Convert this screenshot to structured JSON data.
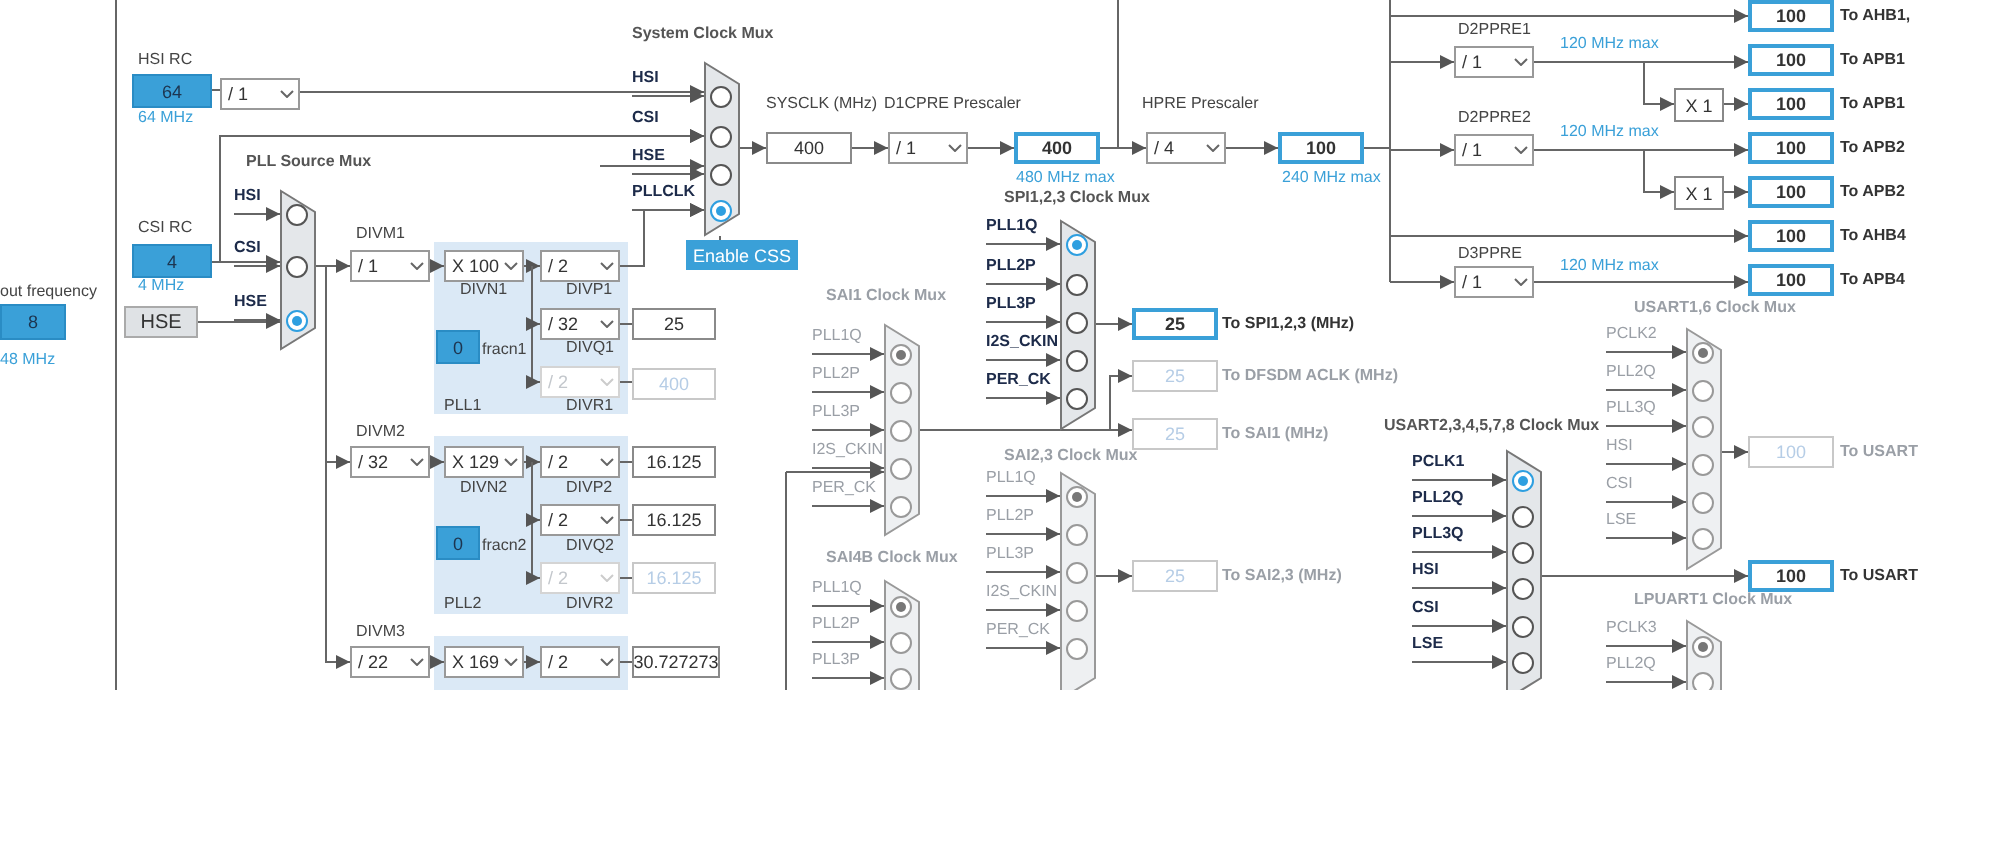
{
  "labels": [
    {
      "text": "out frequency",
      "kind": "caption"
    },
    {
      "text": "48 MHz",
      "kind": "note"
    },
    {
      "text": "HSI RC",
      "kind": "caption"
    },
    {
      "text": "64 MHz",
      "kind": "note"
    },
    {
      "text": "CSI RC",
      "kind": "caption"
    },
    {
      "text": "4 MHz",
      "kind": "note"
    },
    {
      "text": "DIVM1",
      "kind": "caption"
    },
    {
      "text": "DIVN1",
      "kind": "caption"
    },
    {
      "text": "DIVP1",
      "kind": "caption"
    },
    {
      "text": "DIVQ1",
      "kind": "caption"
    },
    {
      "text": "fracn1",
      "kind": "caption"
    },
    {
      "text": "DIVR1",
      "kind": "caption"
    },
    {
      "text": "PLL1",
      "kind": "caption"
    },
    {
      "text": "DIVM2",
      "kind": "caption"
    },
    {
      "text": "DIVN2",
      "kind": "caption"
    },
    {
      "text": "DIVP2",
      "kind": "caption"
    },
    {
      "text": "DIVQ2",
      "kind": "caption"
    },
    {
      "text": "fracn2",
      "kind": "caption"
    },
    {
      "text": "DIVR2",
      "kind": "caption"
    },
    {
      "text": "PLL2",
      "kind": "caption"
    },
    {
      "text": "DIVM3",
      "kind": "caption"
    },
    {
      "text": "SYSCLK (MHz)",
      "kind": "caption"
    },
    {
      "text": "D1CPRE Prescaler",
      "kind": "caption"
    },
    {
      "text": "480 MHz max",
      "kind": "note"
    },
    {
      "text": "HPRE Prescaler",
      "kind": "caption"
    },
    {
      "text": "240 MHz max",
      "kind": "note"
    },
    {
      "text": "D2PPRE1",
      "kind": "caption"
    },
    {
      "text": "120 MHz max",
      "kind": "note"
    },
    {
      "text": "D2PPRE2",
      "kind": "caption"
    },
    {
      "text": "120 MHz max",
      "kind": "note"
    },
    {
      "text": "D3PPRE",
      "kind": "caption"
    },
    {
      "text": "120 MHz max",
      "kind": "note"
    },
    {
      "text": "To AHB1,",
      "kind": "output"
    },
    {
      "text": "To APB1",
      "kind": "output"
    },
    {
      "text": "To APB1",
      "kind": "output"
    },
    {
      "text": "To APB2",
      "kind": "output"
    },
    {
      "text": "To APB2",
      "kind": "output"
    },
    {
      "text": "To AHB4",
      "kind": "output"
    },
    {
      "text": "To APB4",
      "kind": "output"
    },
    {
      "text": "To SPI1,2,3 (MHz)",
      "kind": "output"
    },
    {
      "text": "To DFSDM ACLK (MHz)",
      "kind": "output_off"
    },
    {
      "text": "To SAI1 (MHz)",
      "kind": "output_off"
    },
    {
      "text": "To SAI2,3 (MHz)",
      "kind": "output_off"
    },
    {
      "text": "To USART",
      "kind": "output_off"
    },
    {
      "text": "To USART",
      "kind": "output"
    }
  ],
  "fields": [
    {
      "value": "8",
      "kind": "source",
      "disabled": false
    },
    {
      "value": "64",
      "kind": "source",
      "disabled": false
    },
    {
      "value": "4",
      "kind": "source",
      "disabled": false
    },
    {
      "value": "0",
      "kind": "source",
      "disabled": false
    },
    {
      "value": "0",
      "kind": "source",
      "disabled": false
    },
    {
      "value": "25",
      "kind": "plain",
      "disabled": false
    },
    {
      "value": "400",
      "kind": "plain",
      "disabled": true
    },
    {
      "value": "16.125",
      "kind": "plain",
      "disabled": false
    },
    {
      "value": "16.125",
      "kind": "plain",
      "disabled": false
    },
    {
      "value": "16.125",
      "kind": "plain",
      "disabled": true
    },
    {
      "value": "30.727273",
      "kind": "plain",
      "disabled": false
    },
    {
      "value": "400",
      "kind": "plain",
      "disabled": false
    },
    {
      "value": "400",
      "kind": "output",
      "disabled": false
    },
    {
      "value": "100",
      "kind": "output",
      "disabled": false
    },
    {
      "value": "100",
      "kind": "output",
      "disabled": false
    },
    {
      "value": "100",
      "kind": "output",
      "disabled": false
    },
    {
      "value": "100",
      "kind": "output",
      "disabled": false
    },
    {
      "value": "100",
      "kind": "output",
      "disabled": false
    },
    {
      "value": "100",
      "kind": "output",
      "disabled": false
    },
    {
      "value": "100",
      "kind": "output",
      "disabled": false
    },
    {
      "value": "100",
      "kind": "output",
      "disabled": false
    },
    {
      "value": "25",
      "kind": "output",
      "disabled": false
    },
    {
      "value": "25",
      "kind": "plain",
      "disabled": true
    },
    {
      "value": "25",
      "kind": "plain",
      "disabled": true
    },
    {
      "value": "25",
      "kind": "plain",
      "disabled": true
    },
    {
      "value": "100",
      "kind": "plain",
      "disabled": true
    },
    {
      "value": "100",
      "kind": "output",
      "disabled": false
    }
  ],
  "dividers": [
    {
      "value": "/ 1",
      "disabled": false
    },
    {
      "value": "/ 1",
      "disabled": false
    },
    {
      "value": "X 100",
      "disabled": false
    },
    {
      "value": "/ 2",
      "disabled": false
    },
    {
      "value": "/ 32",
      "disabled": false
    },
    {
      "value": "/ 2",
      "disabled": true
    },
    {
      "value": "/ 32",
      "disabled": false
    },
    {
      "value": "X 129",
      "disabled": false
    },
    {
      "value": "/ 2",
      "disabled": false
    },
    {
      "value": "/ 2",
      "disabled": false
    },
    {
      "value": "/ 2",
      "disabled": true
    },
    {
      "value": "/ 22",
      "disabled": false
    },
    {
      "value": "X 169",
      "disabled": false
    },
    {
      "value": "/ 2",
      "disabled": false
    },
    {
      "value": "/ 1",
      "disabled": false
    },
    {
      "value": "/ 4",
      "disabled": false
    },
    {
      "value": "/ 1",
      "disabled": false
    },
    {
      "value": "/ 1",
      "disabled": false
    },
    {
      "value": "/ 1",
      "disabled": false
    }
  ],
  "multipliers": [
    "X 1",
    "X 1"
  ],
  "buttons": [
    {
      "label": "HSE",
      "kind": "source"
    },
    {
      "label": "Enable CSS",
      "kind": "action"
    }
  ],
  "muxes": [
    {
      "title": "PLL Source Mux",
      "disabled": false,
      "inputs": [
        {
          "label": "HSI",
          "selected": false
        },
        {
          "label": "CSI",
          "selected": false
        },
        {
          "label": "HSE",
          "selected": true
        }
      ]
    },
    {
      "title": "System Clock Mux",
      "disabled": false,
      "inputs": [
        {
          "label": "HSI",
          "selected": false
        },
        {
          "label": "CSI",
          "selected": false
        },
        {
          "label": "HSE",
          "selected": false
        },
        {
          "label": "PLLCLK",
          "selected": true
        }
      ]
    },
    {
      "title": "SPI1,2,3 Clock Mux",
      "disabled": false,
      "inputs": [
        {
          "label": "PLL1Q",
          "selected": true
        },
        {
          "label": "PLL2P",
          "selected": false
        },
        {
          "label": "PLL3P",
          "selected": false
        },
        {
          "label": "I2S_CKIN",
          "selected": false
        },
        {
          "label": "PER_CK",
          "selected": false
        }
      ]
    },
    {
      "title": "SAI1 Clock Mux",
      "disabled": true,
      "inputs": [
        {
          "label": "PLL1Q",
          "selected": true
        },
        {
          "label": "PLL2P",
          "selected": false
        },
        {
          "label": "PLL3P",
          "selected": false
        },
        {
          "label": "I2S_CKIN",
          "selected": false
        },
        {
          "label": "PER_CK",
          "selected": false
        }
      ]
    },
    {
      "title": "SAI2,3 Clock Mux",
      "disabled": true,
      "inputs": [
        {
          "label": "PLL1Q",
          "selected": true
        },
        {
          "label": "PLL2P",
          "selected": false
        },
        {
          "label": "PLL3P",
          "selected": false
        },
        {
          "label": "I2S_CKIN",
          "selected": false
        },
        {
          "label": "PER_CK",
          "selected": false
        }
      ]
    },
    {
      "title": "SAI4B Clock Mux",
      "disabled": true,
      "inputs": [
        {
          "label": "PLL1Q",
          "selected": true
        },
        {
          "label": "PLL2P",
          "selected": false
        },
        {
          "label": "PLL3P",
          "selected": false
        }
      ]
    },
    {
      "title": "USART1,6 Clock Mux",
      "disabled": true,
      "inputs": [
        {
          "label": "PCLK2",
          "selected": true
        },
        {
          "label": "PLL2Q",
          "selected": false
        },
        {
          "label": "PLL3Q",
          "selected": false
        },
        {
          "label": "HSI",
          "selected": false
        },
        {
          "label": "CSI",
          "selected": false
        },
        {
          "label": "LSE",
          "selected": false
        }
      ]
    },
    {
      "title": "USART2,3,4,5,7,8 Clock Mux",
      "disabled": false,
      "inputs": [
        {
          "label": "PCLK1",
          "selected": true
        },
        {
          "label": "PLL2Q",
          "selected": false
        },
        {
          "label": "PLL3Q",
          "selected": false
        },
        {
          "label": "HSI",
          "selected": false
        },
        {
          "label": "CSI",
          "selected": false
        },
        {
          "label": "LSE",
          "selected": false
        }
      ]
    },
    {
      "title": "LPUART1 Clock Mux",
      "disabled": true,
      "inputs": [
        {
          "label": "PCLK3",
          "selected": true
        },
        {
          "label": "PLL2Q",
          "selected": false
        }
      ]
    }
  ]
}
